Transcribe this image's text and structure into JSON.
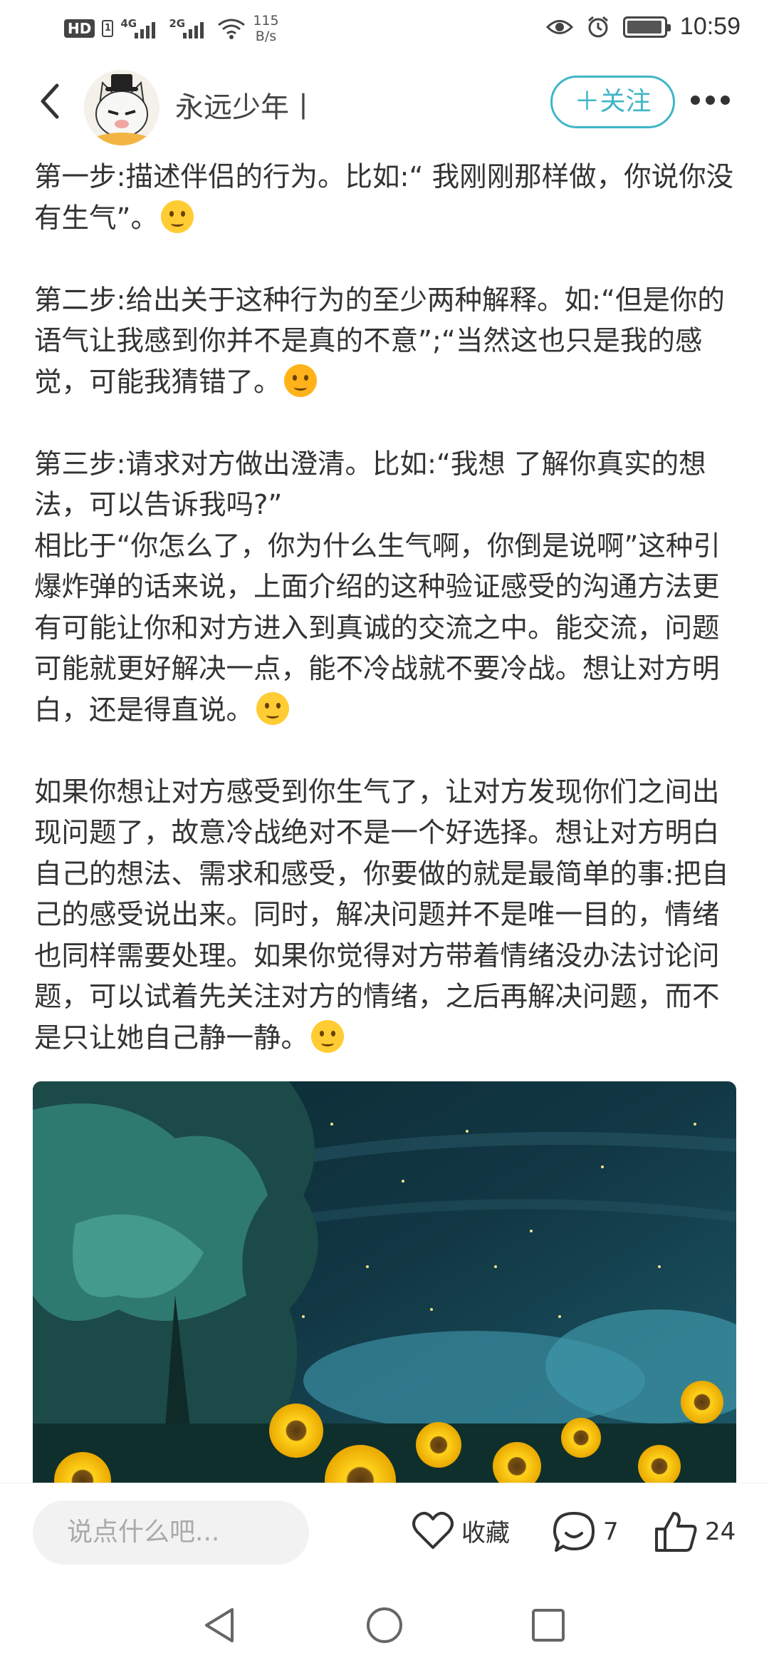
{
  "status_bar": {
    "hd_badge": "HD",
    "sim_badge": "1",
    "net1": "4G",
    "net2": "2G",
    "speed_value": "115",
    "speed_unit": "B/s",
    "time": "10:59"
  },
  "header": {
    "author_name": "永远少年丨",
    "follow_label": "＋关注"
  },
  "article": {
    "paragraphs": [
      "第一步:描述伴侣的行为。比如:“ 我刚刚那样做，你说你没有生气”。",
      "第二步:给出关于这种行为的至少两种解释。如:“但是你的语气让我感到你并不是真的不意”;“当然这也只是我的感觉，可能我猜错了。",
      "第三步:请求对方做出澄清。比如:“我想 了解你真实的想法，可以告诉我吗?”",
      "相比于“你怎么了，你为什么生气啊，你倒是说啊”这种引爆炸弹的话来说，上面介绍的这种验证感受的沟通方法更有可能让你和对方进入到真诚的交流之中。能交流，问题可能就更好解决一点，能不冷战就不要冷战。想让对方明白，还是得直说。",
      "如果你想让对方感受到你生气了，让对方发现你们之间出现问题了，故意冷战绝对不是一个好选择。想让对方明白自己的想法、需求和感受，你要做的就是最简单的事:把自己的感受说出来。同时，解决问题并不是唯一目的，情绪也同样需要处理。如果你觉得对方带着情绪没办法讨论问题，可以试着先关注对方的情绪，之后再解决问题，而不是只让她自己静一静。"
    ],
    "emoji": [
      "thinking-face",
      "disappointed-face",
      "hugging-face",
      "shushing-face"
    ]
  },
  "bottom_bar": {
    "comment_placeholder": "说点什么吧...",
    "favorite_label": "收藏",
    "comment_count": "7",
    "like_count": "24"
  },
  "colors": {
    "accent": "#3fb6c8",
    "text": "#333333",
    "input_bg": "#f2f2f2"
  }
}
